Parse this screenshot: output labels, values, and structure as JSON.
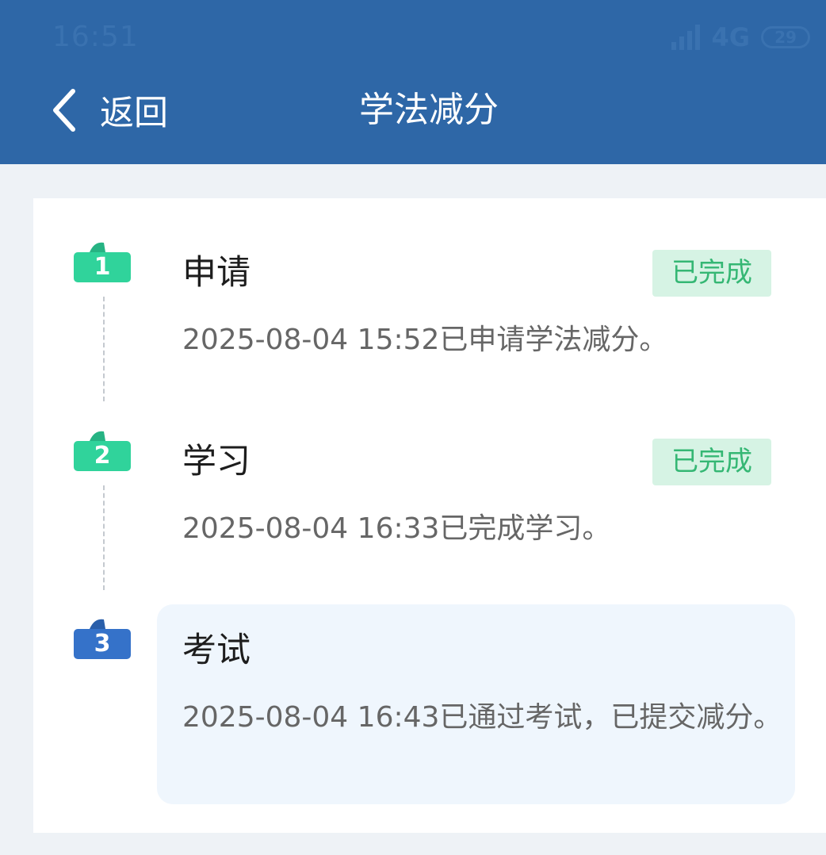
{
  "status_bar": {
    "time": "16:51",
    "network": "4G",
    "battery": "29"
  },
  "header": {
    "back_label": "返回",
    "title": "学法减分"
  },
  "steps": [
    {
      "number": "1",
      "title": "申请",
      "description": "2025-08-04 15:52已申请学法减分。",
      "status": "已完成",
      "badge_color": "#30d39b"
    },
    {
      "number": "2",
      "title": "学习",
      "description": "2025-08-04 16:33已完成学习。",
      "status": "已完成",
      "badge_color": "#30d39b"
    },
    {
      "number": "3",
      "title": "考试",
      "description": "2025-08-04 16:43已通过考试，已提交减分。",
      "status": "",
      "badge_color": "#3572c9"
    }
  ],
  "colors": {
    "header_bg": "#2e67a7",
    "done_badge_bg": "#d6f3e4",
    "done_badge_text": "#35b774",
    "active_panel_bg": "#eff6fd"
  }
}
